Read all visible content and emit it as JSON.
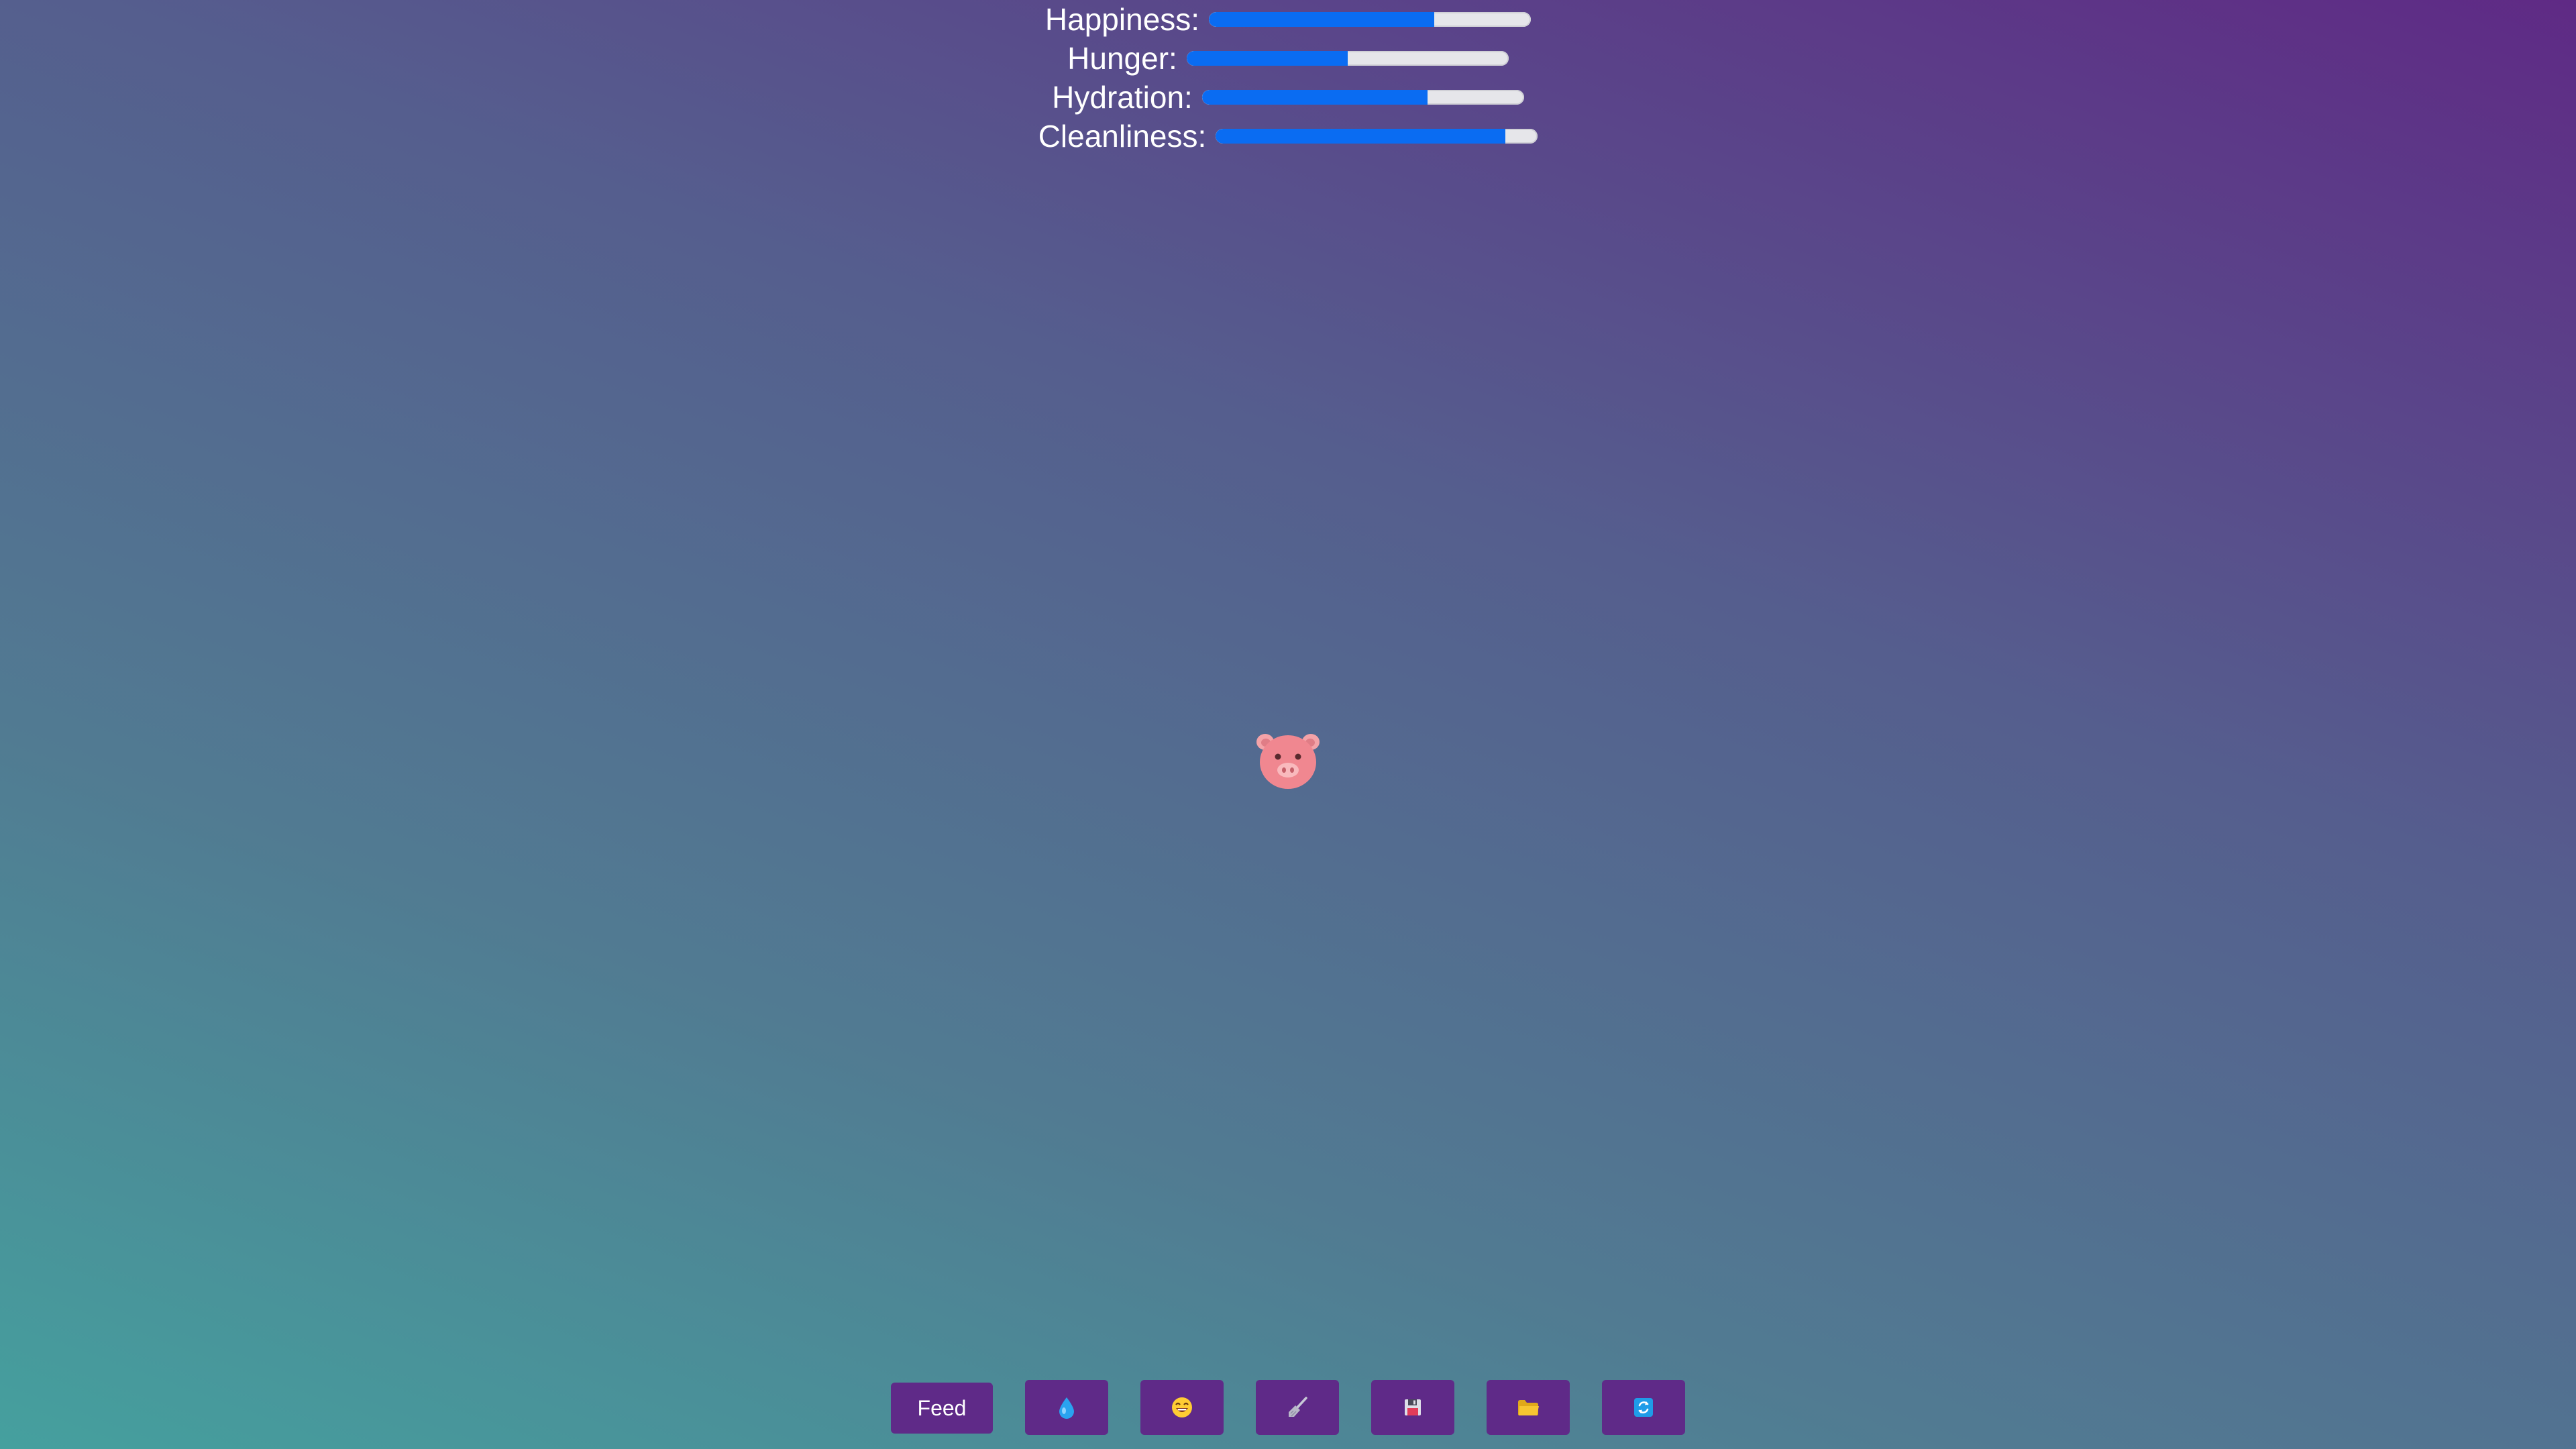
{
  "stats": [
    {
      "label": "Happiness:",
      "value": 0.7
    },
    {
      "label": "Hunger:",
      "value": 0.5
    },
    {
      "label": "Hydration:",
      "value": 0.7
    },
    {
      "label": "Cleanliness:",
      "value": 0.9
    }
  ],
  "pet": {
    "icon": "pig-face-icon"
  },
  "toolbar": {
    "feed_label": "Feed",
    "buttons": [
      {
        "icon": "water-drop-icon"
      },
      {
        "icon": "grinning-face-icon"
      },
      {
        "icon": "broom-icon"
      },
      {
        "icon": "floppy-disk-icon"
      },
      {
        "icon": "folder-icon"
      },
      {
        "icon": "refresh-icon"
      }
    ]
  },
  "colors": {
    "bar_fill": "#0a6cf2",
    "bar_track": "#e6e6ea",
    "button_bg": "#5f2a88"
  }
}
